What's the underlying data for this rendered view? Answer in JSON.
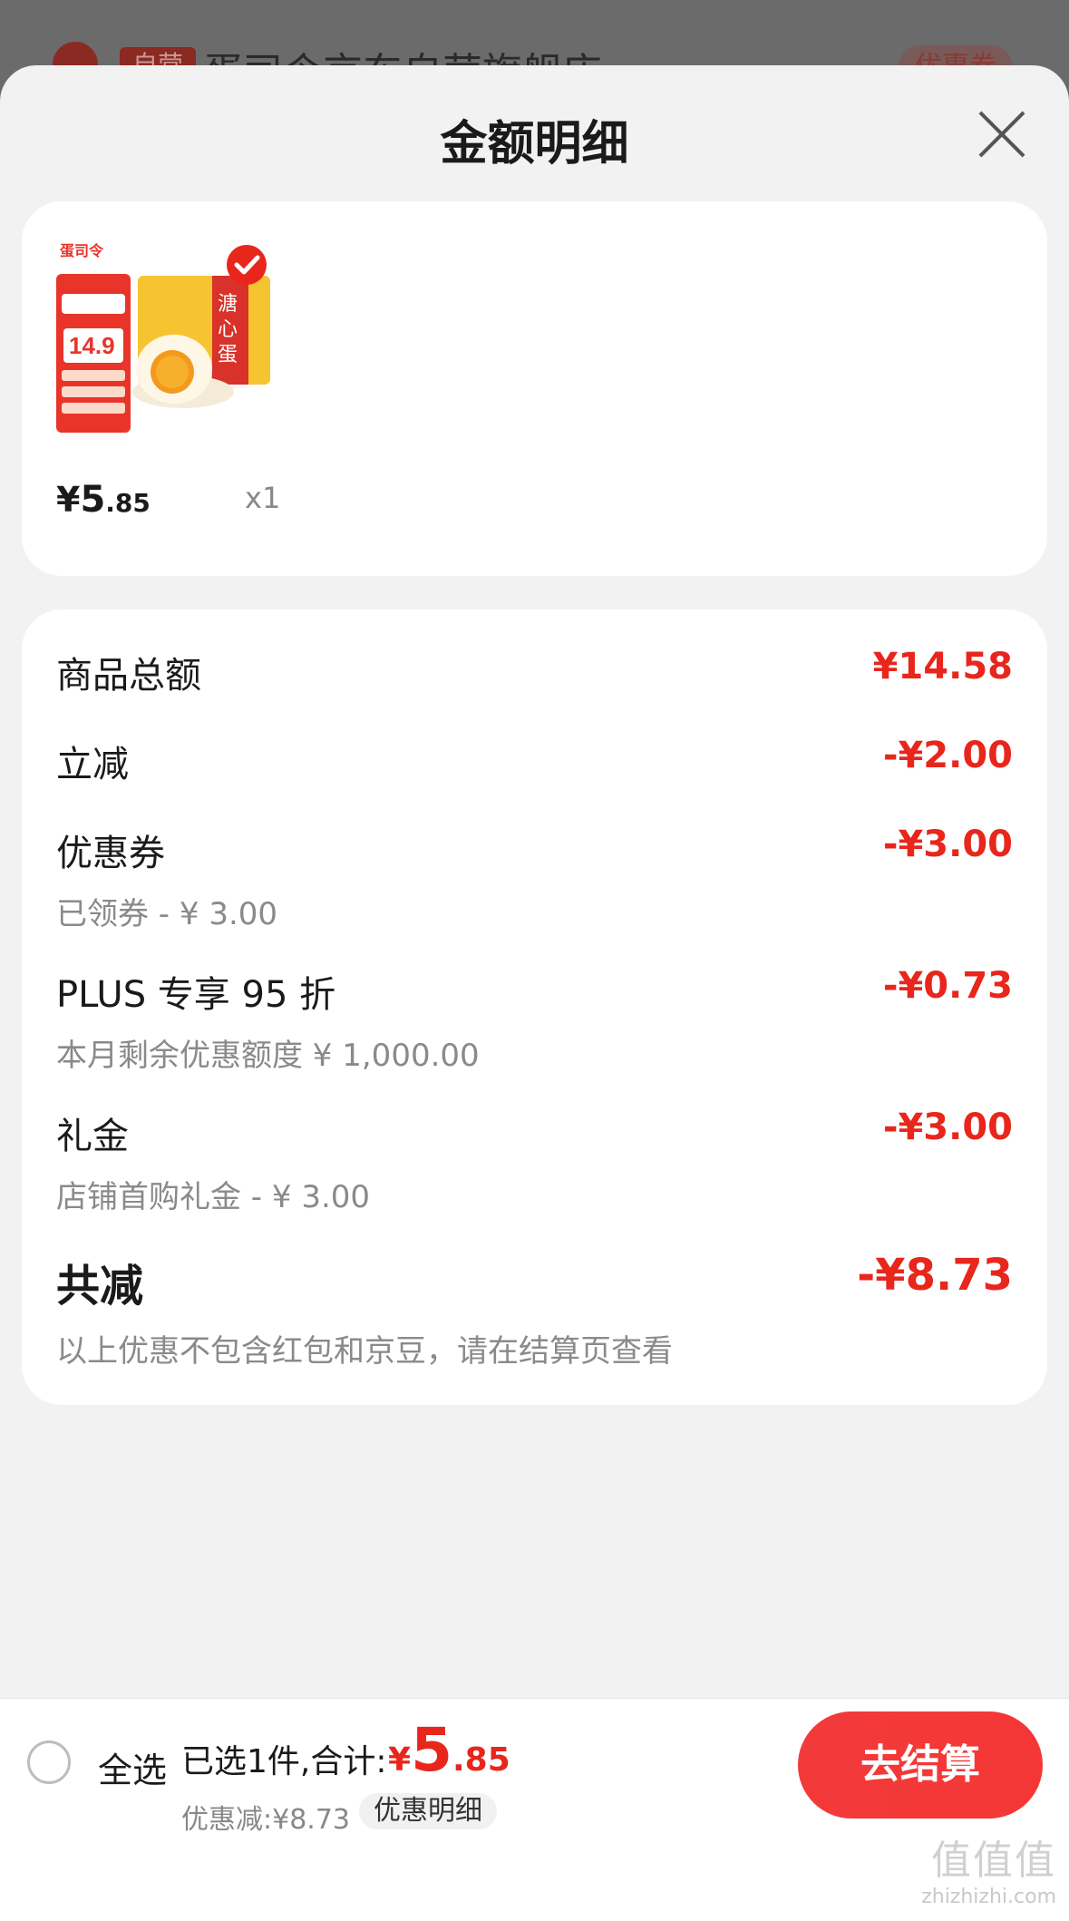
{
  "background": {
    "tag": "自营",
    "store_name": "蛋司令京东自营旗舰店 ›",
    "coupon": "优惠券"
  },
  "sheet": {
    "title": "金额明细"
  },
  "product": {
    "image_label": "鸡蛋咸蛋礼盒 产品图",
    "brand_logo_text": "蛋司令",
    "price_symbol": "¥",
    "price_int": "5",
    "price_dec": ".85",
    "quantity": "x1"
  },
  "details": {
    "rows": [
      {
        "label": "商品总额",
        "amount": "¥14.58",
        "sub": ""
      },
      {
        "label": "立减",
        "amount": "-¥2.00",
        "sub": ""
      },
      {
        "label": "优惠券",
        "amount": "-¥3.00",
        "sub": "已领券 - ¥ 3.00"
      },
      {
        "label": "PLUS 专享 95 折",
        "amount": "-¥0.73",
        "sub": "本月剩余优惠额度 ¥ 1,000.00"
      },
      {
        "label": "礼金",
        "amount": "-¥3.00",
        "sub": "店铺首购礼金 - ¥ 3.00"
      }
    ],
    "total": {
      "label": "共减",
      "amount": "-¥8.73",
      "sub": "以上优惠不包含红包和京豆，请在结算页查看"
    }
  },
  "bottom": {
    "select_all": "全选",
    "selected_text": "已选1件,合计:",
    "price_symbol": "¥",
    "price_int": "5",
    "price_dec": ".85",
    "discount_text": "优惠减:¥8.73",
    "discount_detail": "优惠明细",
    "checkout": "去结算"
  },
  "watermark": {
    "big": "值值值",
    "small": "zhizhizhi.com"
  },
  "colors": {
    "accent": "#e8261c",
    "sheet_bg": "#f2f2f2"
  }
}
